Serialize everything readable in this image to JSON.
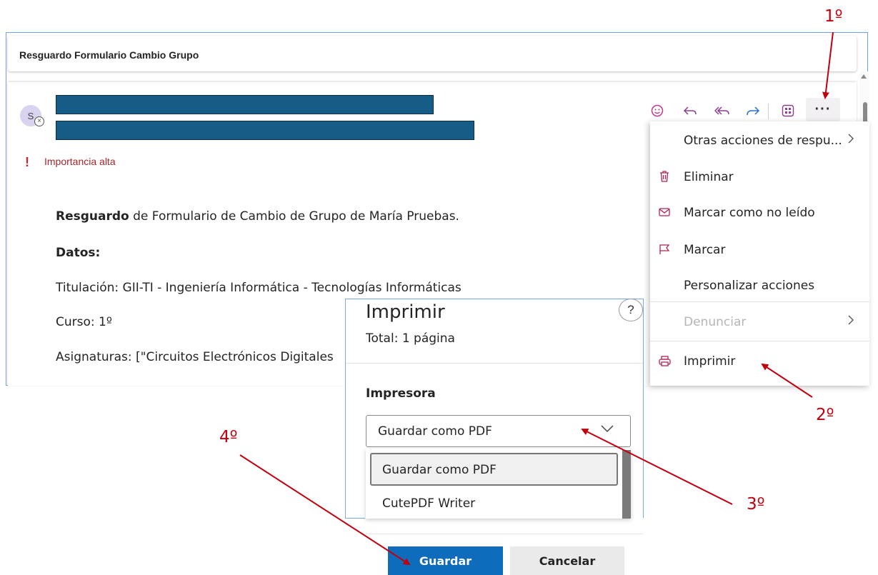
{
  "email": {
    "subject": "Resguardo Formulario Cambio Grupo",
    "avatar_initial": "S",
    "importance": "Importancia alta",
    "body": {
      "line1_bold": "Resguardo",
      "line1_rest": " de Formulario de Cambio de Grupo de María Pruebas.",
      "datos": "Datos:",
      "titulacion": "Titulación: GII-TI - Ingeniería Informática - Tecnologías Informáticas",
      "curso": "Curso: 1º",
      "asignaturas": "Asignaturas: [\"Circuitos Electrónicos Digitales"
    }
  },
  "toolbar": {
    "emoji_icon": "😊",
    "reply_icon": "↶",
    "reply_all_icon": "⟲",
    "forward_icon": "↷",
    "apps_icon": "▦",
    "more_icon": "···"
  },
  "menu": {
    "items": [
      {
        "label": "Otras acciones de respu...",
        "icon": "",
        "chevron": "›"
      },
      {
        "label": "Eliminar",
        "icon": "trash-icon"
      },
      {
        "label": "Marcar como no leído",
        "icon": "envelope-icon"
      },
      {
        "label": "Marcar",
        "icon": "flag-icon"
      },
      {
        "label": "Personalizar acciones",
        "icon": ""
      },
      {
        "label": "Denunciar",
        "icon": "",
        "chevron": "›",
        "disabled": true
      },
      {
        "label": "Imprimir",
        "icon": "printer-icon"
      }
    ]
  },
  "print_dialog": {
    "title": "Imprimir",
    "total": "Total: 1 página",
    "help": "?",
    "printer_label": "Impresora",
    "printer_value": "Guardar como PDF",
    "options": [
      "Guardar como PDF",
      "CutePDF Writer"
    ],
    "save_button": "Guardar",
    "cancel_button": "Cancelar"
  },
  "annotations": {
    "step1": "1º",
    "step2": "2º",
    "step3": "3º",
    "step4": "4º",
    "color": "#c0000c"
  }
}
